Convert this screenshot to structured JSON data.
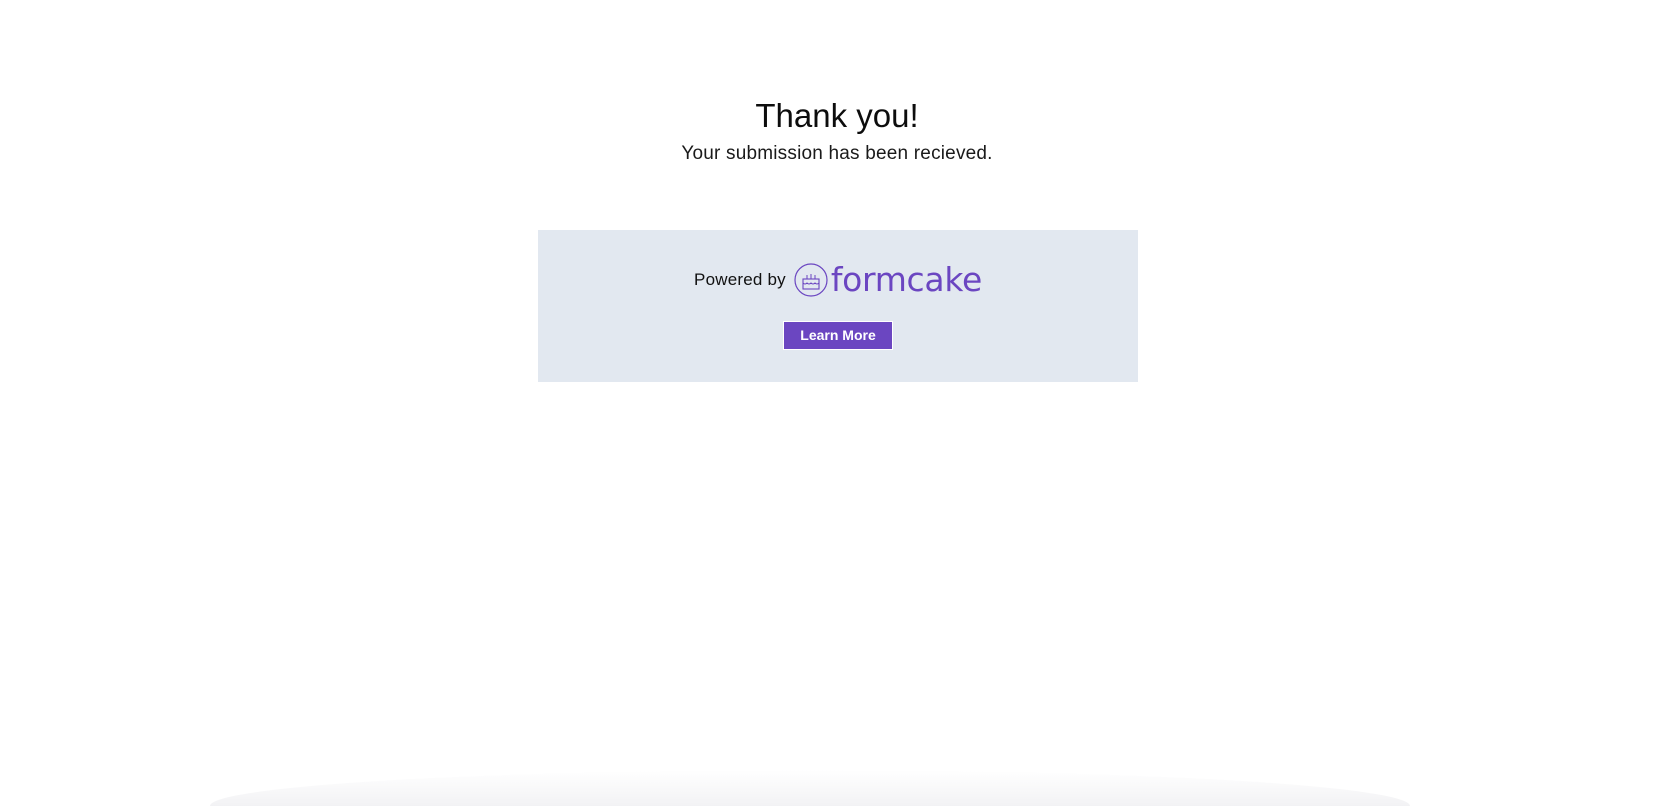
{
  "confirmation": {
    "title": "Thank you!",
    "message": "Your submission has been recieved."
  },
  "promo": {
    "powered_by": "Powered by",
    "brand_name": "formcake",
    "brand_icon": "cake-icon",
    "learn_more_label": "Learn More"
  },
  "colors": {
    "brand": "#6b46c1",
    "promo_background": "#e2e8f0",
    "page_background": "#ffffff"
  }
}
